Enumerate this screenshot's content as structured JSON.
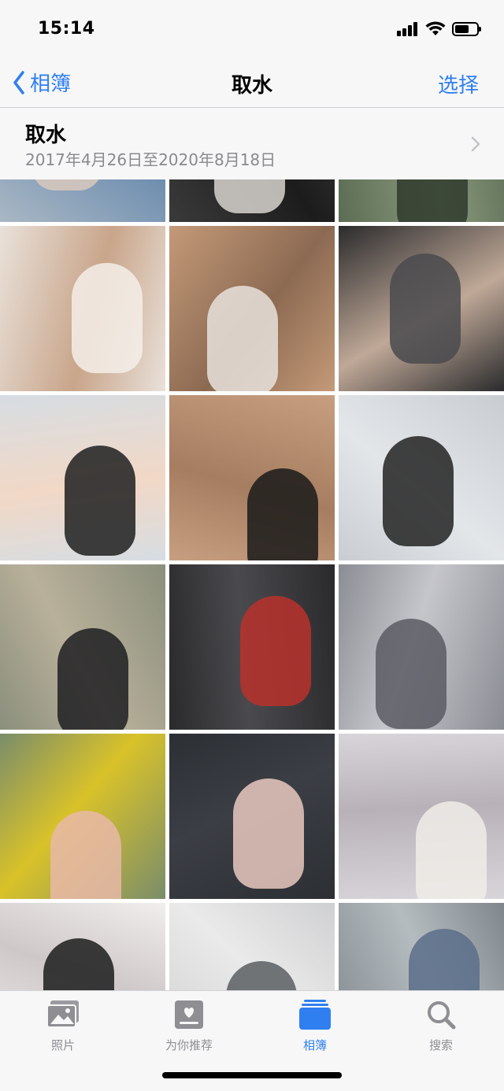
{
  "status_bar": {
    "time": "15:14",
    "battery_level": 0.65
  },
  "nav": {
    "back_label": "相簿",
    "title": "取水",
    "select_label": "选择"
  },
  "album": {
    "name": "取水",
    "date_range": "2017年4月26日至2020年8月18日"
  },
  "grid": {
    "photos": [
      {
        "name": "photo-1",
        "palette": [
          "#a9b7c4",
          "#d9c8bd",
          "#6f8fb0"
        ]
      },
      {
        "name": "photo-2",
        "palette": [
          "#3a3a3a",
          "#d8d4cf",
          "#1c1c1c"
        ]
      },
      {
        "name": "photo-3",
        "palette": [
          "#5d6d55",
          "#2f3a2c",
          "#8a9a7e"
        ]
      },
      {
        "name": "photo-4",
        "palette": [
          "#e9e1da",
          "#f4efe9",
          "#c9a58a"
        ]
      },
      {
        "name": "photo-5",
        "palette": [
          "#c49a78",
          "#e8e2dc",
          "#8c6a52"
        ]
      },
      {
        "name": "photo-6",
        "palette": [
          "#2b2b2d",
          "#4a4a4e",
          "#bfa897"
        ]
      },
      {
        "name": "photo-7",
        "palette": [
          "#d6dde3",
          "#1e1e20",
          "#f2d8c6"
        ]
      },
      {
        "name": "photo-8",
        "palette": [
          "#c79f80",
          "#1a1a1a",
          "#a67d60"
        ]
      },
      {
        "name": "photo-9",
        "palette": [
          "#c9cdd2",
          "#222",
          "#e3e6e9"
        ]
      },
      {
        "name": "photo-10",
        "palette": [
          "#8a8f7c",
          "#1f1f22",
          "#b9b09a"
        ]
      },
      {
        "name": "photo-11",
        "palette": [
          "#2a2a2c",
          "#b8312c",
          "#4a4a4e"
        ]
      },
      {
        "name": "photo-12",
        "palette": [
          "#8b8d94",
          "#5a5c63",
          "#c5c6cb"
        ]
      },
      {
        "name": "photo-13",
        "palette": [
          "#7a8d6b",
          "#e8b8a8",
          "#d9c229"
        ]
      },
      {
        "name": "photo-14",
        "palette": [
          "#2c2f34",
          "#e9c9bf",
          "#3b3e44"
        ]
      },
      {
        "name": "photo-15",
        "palette": [
          "#d8d5da",
          "#f0ece8",
          "#b8b2b8"
        ]
      },
      {
        "name": "photo-16",
        "palette": [
          "#f1eeee",
          "#1c1c1c",
          "#cfc8c8"
        ]
      },
      {
        "name": "photo-17",
        "palette": [
          "#cfd0d1",
          "#5b5e62",
          "#eaeaea"
        ]
      },
      {
        "name": "photo-18",
        "palette": [
          "#7f878c",
          "#5b6d8a",
          "#b5bcc0"
        ]
      }
    ]
  },
  "tabs": [
    {
      "label": "照片",
      "icon": "photos-icon",
      "active": false
    },
    {
      "label": "为你推荐",
      "icon": "for-you-icon",
      "active": false
    },
    {
      "label": "相簿",
      "icon": "albums-icon",
      "active": true
    },
    {
      "label": "搜索",
      "icon": "search-icon",
      "active": false
    }
  ],
  "colors": {
    "accent": "#2f7ff0",
    "inactive": "#8e8e93",
    "bar_bg": "#f7f7f8"
  }
}
